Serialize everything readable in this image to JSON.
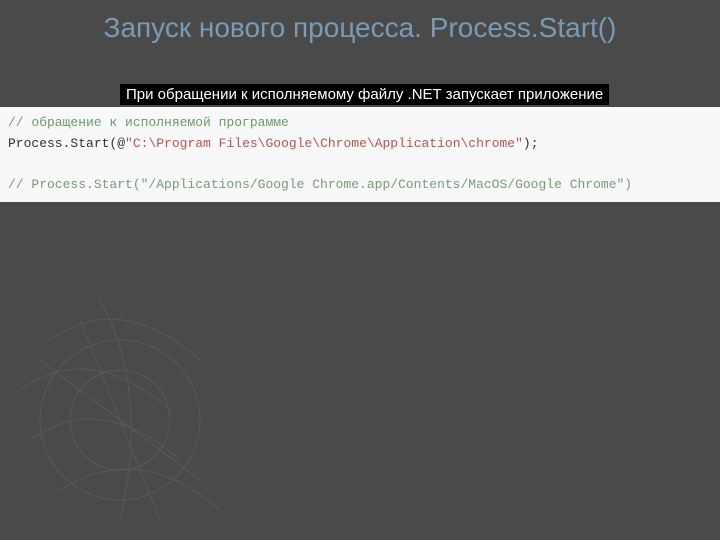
{
  "title": "Запуск нового процесса. Process.Start()",
  "subtitle": "При обращении к исполняемому файлу .NET запускает приложение",
  "code": {
    "line1_comment": "// обращение к исполняемой программе",
    "line2_method": "Process.Start",
    "line2_paren_open": "(",
    "line2_at": "@",
    "line2_string": "\"C:\\Program Files\\Google\\Chrome\\Application\\chrome\"",
    "line2_paren_close": ");",
    "line3_empty": "",
    "line4_comment": "// Process.Start(\"/Applications/Google Chrome.app/Contents/MacOS/Google Chrome\")"
  }
}
